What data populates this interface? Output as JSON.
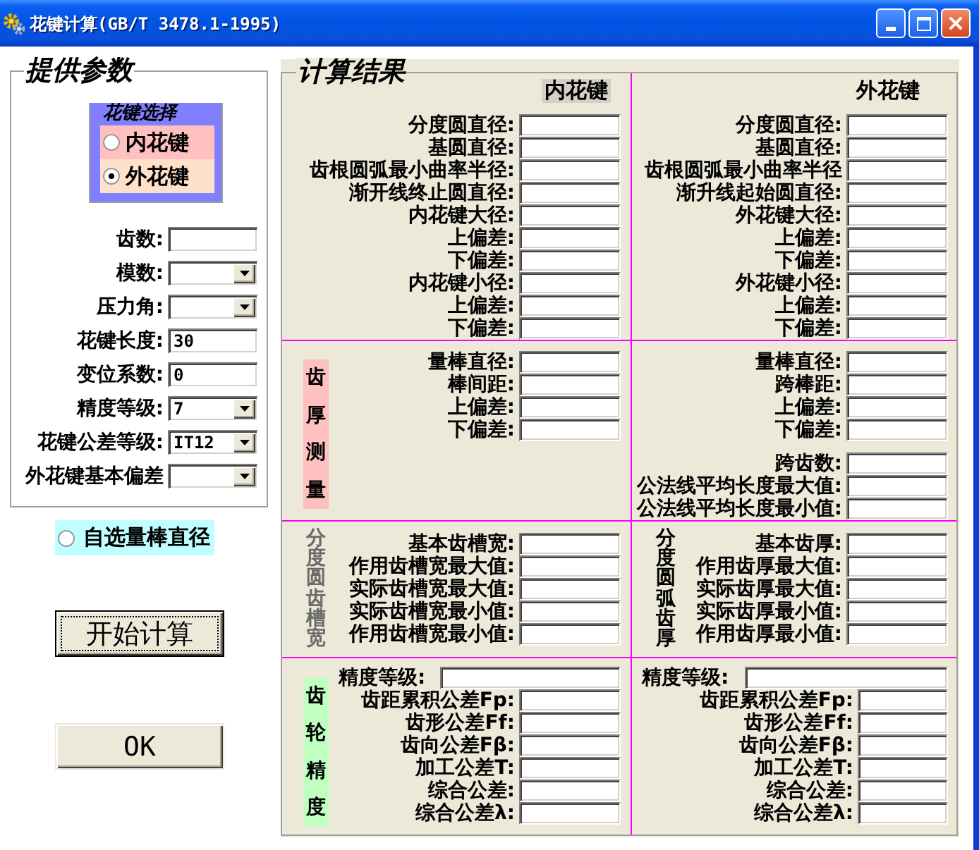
{
  "window": {
    "title": "花键计算(GB/T 3478.1-1995)"
  },
  "parameters": {
    "title": "提供参数",
    "spline_selection": {
      "title": "花键选择",
      "options": [
        {
          "label": "内花键",
          "selected": false,
          "color": "#ffc0c0"
        },
        {
          "label": "外花键",
          "selected": true,
          "color": "#ffe0c8"
        }
      ]
    },
    "fields": [
      {
        "label": "齿数:",
        "kind": "text"
      },
      {
        "label": "模数:",
        "kind": "combo"
      },
      {
        "label": "压力角:",
        "kind": "combo"
      },
      {
        "label": "花键长度:",
        "kind": "text",
        "value": "30"
      },
      {
        "label": "变位系数:",
        "kind": "text",
        "value": "0"
      },
      {
        "label": "精度等级:",
        "kind": "combo",
        "value": "7"
      },
      {
        "label": "花键公差等级:",
        "kind": "combo",
        "value": "IT12"
      },
      {
        "label": "外花键基本偏差",
        "kind": "combo"
      }
    ]
  },
  "custom_rod_diameter": {
    "label": "自选量棒直径",
    "selected": false
  },
  "buttons": [
    {
      "label": "开始计算",
      "default": true
    },
    {
      "label": "OK",
      "default": false
    }
  ],
  "results": {
    "title": "计算结果",
    "sections": [
      {
        "kind": "dimensions",
        "panes": [
          {
            "header": {
              "text": "内花键",
              "highlighted": true
            },
            "field_groups": [
              [
                "分度圆直径:",
                "基圆直径:",
                "齿根圆弧最小曲率半径:",
                "渐开线终止圆直径:",
                "内花键大径:",
                "上偏差:",
                "下偏差:",
                "内花键小径:",
                "上偏差:",
                "下偏差:"
              ]
            ]
          },
          {
            "header": {
              "text": "外花键",
              "highlighted": false
            },
            "field_groups": [
              [
                "分度圆直径:",
                "基圆直径:",
                "齿根圆弧最小曲率半径",
                "渐升线起始圆直径:",
                "外花键大径:",
                "上偏差:",
                "下偏差:",
                "外花键小径:",
                "上偏差:",
                "下偏差:"
              ]
            ]
          }
        ]
      },
      {
        "kind": "measurement",
        "panes": [
          {
            "side_label": {
              "text": "齿厚测量",
              "color": "#ffc0c0",
              "disabled": false
            },
            "field_groups": [
              [
                "量棒直径:",
                "棒间距:",
                "上偏差:",
                "下偏差:"
              ]
            ]
          },
          {
            "field_groups": [
              [
                "量棒直径:",
                "跨棒距:",
                "上偏差:",
                "下偏差:"
              ],
              [
                "跨齿数:",
                "公法线平均长度最大值:",
                "公法线平均长度最小值:"
              ]
            ]
          }
        ]
      },
      {
        "kind": "thickness",
        "panes": [
          {
            "side_label": {
              "text": "分度圆齿槽宽",
              "disabled": true
            },
            "field_groups": [
              [
                "基本齿槽宽:",
                "作用齿槽宽最大值:",
                "实际齿槽宽最大值:",
                "实际齿槽宽最小值:",
                "作用齿槽宽最小值:"
              ]
            ]
          },
          {
            "side_label": {
              "text": "分度圆弧齿厚",
              "disabled": false
            },
            "field_groups": [
              [
                "基本齿厚:",
                "作用齿厚最大值:",
                "实际齿厚最大值:",
                "实际齿厚最小值:",
                "作用齿厚最小值:"
              ]
            ]
          }
        ]
      },
      {
        "kind": "tolerance",
        "panes": [
          {
            "side_label": {
              "text": "齿轮精度",
              "color": "#c0ffc0",
              "disabled": false
            },
            "precision": {
              "label": "精度等级:"
            },
            "field_groups": [
              [
                "齿距累积公差Fp:",
                "齿形公差Ff:",
                "齿向公差Fβ:",
                "加工公差T:",
                "综合公差:",
                "综合公差λ:"
              ]
            ]
          },
          {
            "precision": {
              "label": "精度等级:"
            },
            "field_groups": [
              [
                "齿距累积公差Fp:",
                "齿形公差Ff:",
                "齿向公差Fβ:",
                "加工公差T:",
                "综合公差:",
                "综合公差λ:"
              ]
            ]
          }
        ]
      }
    ]
  }
}
